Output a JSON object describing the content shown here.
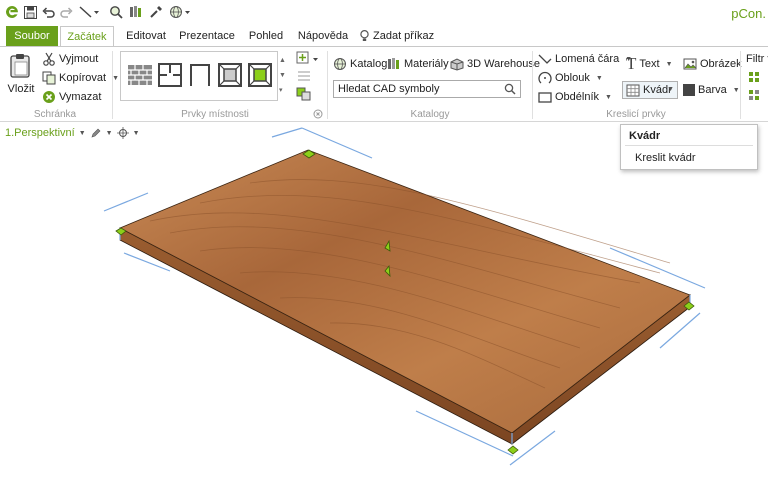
{
  "app": {
    "title": "pCon."
  },
  "quick_access": {
    "icons": [
      "app-logo-icon",
      "save-icon",
      "undo-icon",
      "redo-icon",
      "line-tool-icon",
      "zoom-icon",
      "catalog-icon",
      "eyedropper-icon",
      "globe-icon"
    ]
  },
  "tabs": [
    {
      "label": "Soubor"
    },
    {
      "label": "Začátek"
    },
    {
      "label": "Editovat"
    },
    {
      "label": "Prezentace"
    },
    {
      "label": "Pohled"
    },
    {
      "label": "Nápověda"
    },
    {
      "label": "Zadat příkaz"
    }
  ],
  "ribbon": {
    "clipboard": {
      "paste_label": "Vložit",
      "cut_label": "Vyjmout",
      "copy_label": "Kopírovat",
      "delete_label": "Vymazat",
      "group_label": "Schránka"
    },
    "room": {
      "group_label": "Prvky místnosti"
    },
    "catalogs": {
      "catalog_label": "Katalog",
      "materials_label": "Materiály",
      "warehouse_label": "3D Warehouse",
      "search_value": "Hledat CAD symboly",
      "group_label": "Katalogy"
    },
    "drawing": {
      "polyline_label": "Lomená čára",
      "arc_label": "Oblouk",
      "rectangle_label": "Obdélník",
      "text_label": "Text",
      "box_label": "Kvádr",
      "image_label": "Obrázek",
      "color_label": "Barva",
      "group_label": "Kreslicí prvky"
    },
    "filter": {
      "label": "Filtr v"
    }
  },
  "viewport": {
    "label": "1.Perspektivní"
  },
  "tooltip": {
    "title": "Kvádr",
    "description": "Kreslit kvádr"
  },
  "colors": {
    "accent": "#6aa01b",
    "wood": "#b06e3c",
    "selection": "#7aa8e0",
    "handle": "#8ccf1a"
  }
}
